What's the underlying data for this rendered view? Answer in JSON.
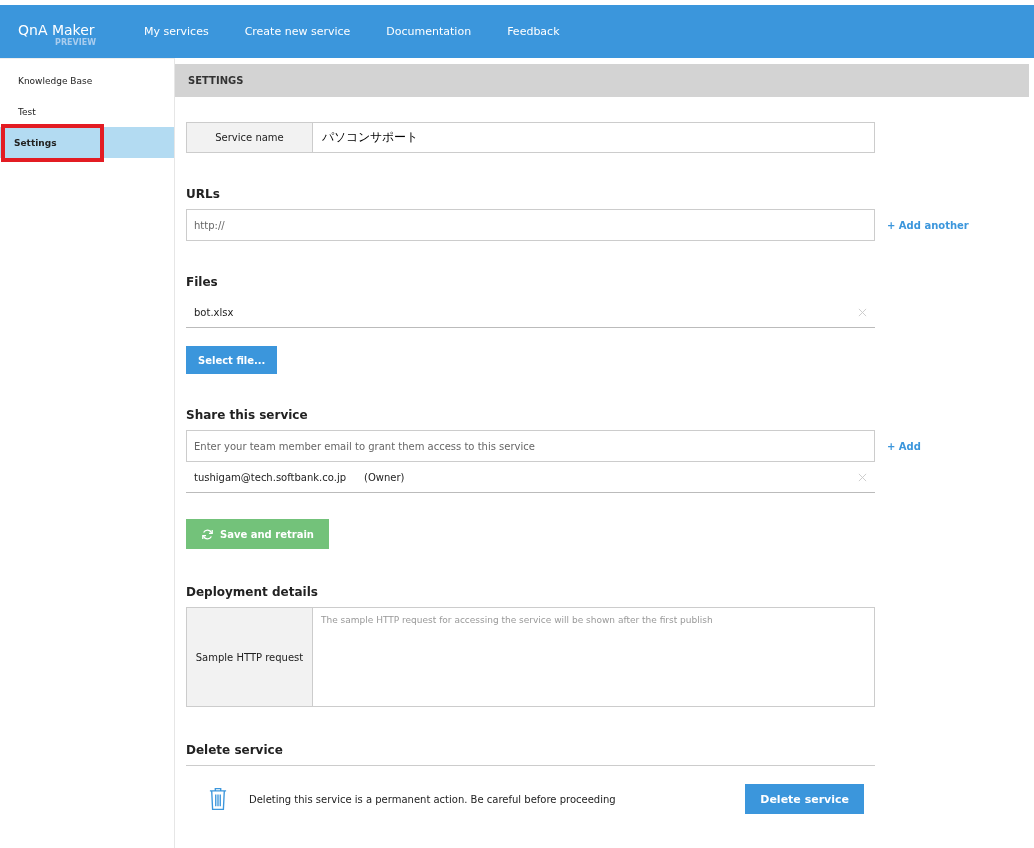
{
  "header": {
    "logo": "QnA Maker",
    "logo_badge": "PREVIEW",
    "nav": [
      {
        "label": "My services"
      },
      {
        "label": "Create new service"
      },
      {
        "label": "Documentation"
      },
      {
        "label": "Feedback"
      }
    ]
  },
  "sidebar": {
    "items": [
      {
        "label": "Knowledge Base",
        "selected": false,
        "highlighted": false
      },
      {
        "label": "Test",
        "selected": false,
        "highlighted": false
      },
      {
        "label": "Settings",
        "selected": true,
        "highlighted": true
      }
    ]
  },
  "page_title": "SETTINGS",
  "service_name": {
    "label": "Service name",
    "value": "パソコンサポート"
  },
  "urls": {
    "heading": "URLs",
    "placeholder": "http://",
    "add_link": "+ Add another"
  },
  "files": {
    "heading": "Files",
    "items": [
      {
        "name": "bot.xlsx"
      }
    ],
    "button": "Select file..."
  },
  "share": {
    "heading": "Share this service",
    "placeholder": "Enter your team member email to grant them access to this service",
    "add_link": "+ Add",
    "members": [
      {
        "email": "tushigam@tech.softbank.co.jp",
        "role": "(Owner)"
      }
    ]
  },
  "save_button": "Save and retrain",
  "deployment": {
    "heading": "Deployment details",
    "label": "Sample HTTP request",
    "placeholder": "The sample HTTP request for accessing the service will be shown after the first publish"
  },
  "delete": {
    "heading": "Delete service",
    "message": "Deleting this service is a permanent action. Be careful before proceeding",
    "button": "Delete service"
  }
}
